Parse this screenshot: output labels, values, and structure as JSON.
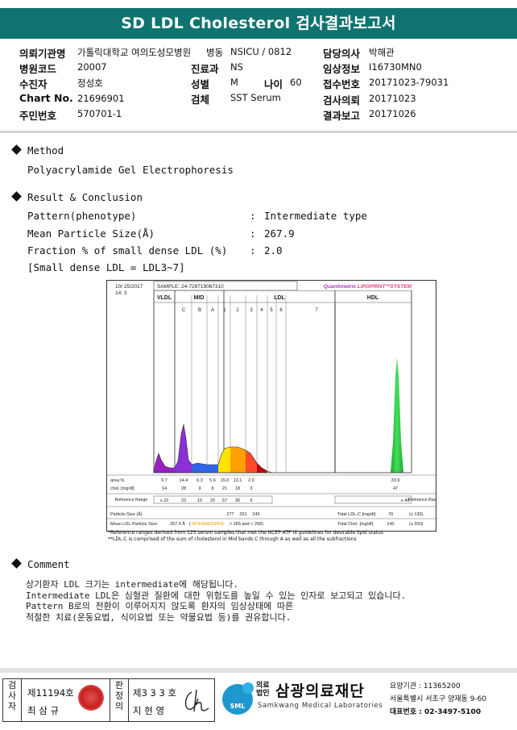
{
  "header": {
    "title": "SD LDL Cholesterol 검사결과보고서"
  },
  "info": {
    "institution_label": "의뢰기관명",
    "institution": "가톨릭대학교 여의도성모병원",
    "ward_label": "병동",
    "ward": "NSICU / 0812",
    "doctor_label": "담당의사",
    "doctor": "박해관",
    "hospital_code_label": "병원코드",
    "hospital_code": "20007",
    "dept_label": "진료과",
    "dept": "NS",
    "clinical_label": "임상정보",
    "clinical": "I16730MN0",
    "patient_label": "수진자",
    "patient": "정성호",
    "sex_label": "성별",
    "sex": "M",
    "age_label": "나이",
    "age": "60",
    "receipt_label": "접수번호",
    "receipt": "20171023-79031",
    "chart_label": "Chart No.",
    "chart": "21696901",
    "specimen_label": "검체",
    "specimen": "SST Serum",
    "request_label": "검사의뢰",
    "request": "20171023",
    "id_label": "주민번호",
    "id": "570701-1",
    "report_label": "결과보고",
    "report": "20171026"
  },
  "method": {
    "heading": "Method",
    "text": "Polyacrylamide Gel Electrophoresis"
  },
  "result": {
    "heading": "Result & Conclusion",
    "pattern_label": "Pattern(phenotype)",
    "pattern_colon": ":",
    "pattern_value": "Intermediate type",
    "size_label": "Mean Particle Size(Å)",
    "size_colon": ":",
    "size_value": "267.9",
    "fraction_label": "Fraction % of small dense LDL (%)",
    "fraction_colon": ":",
    "fraction_value": "2.0",
    "note": "[Small dense LDL = LDL3~7]"
  },
  "chart_data": {
    "type": "area",
    "date": "10/ 25/2017",
    "time": "14: 3",
    "sample": "SAMPLE:  24-729719067310",
    "brand_a": "Quantimetrix",
    "brand_b": "LIPOPRINT",
    "brand_tm": "TM",
    "brand_c": "SYSTEM",
    "top_groups": [
      "VLDL",
      "MID",
      "LDL",
      "HDL"
    ],
    "sub_bands": [
      "C",
      "B",
      "A",
      "1",
      "2",
      "3",
      "4",
      "5",
      "6",
      "7"
    ],
    "rows": {
      "area_label": "area %",
      "area": [
        "9.7",
        "14.4",
        "6.3",
        "5.6",
        "15.0",
        "13.1",
        "2.0",
        "33.9"
      ],
      "chol_label": "chol. [mg/dl]",
      "chol": [
        "14",
        "28",
        "9",
        "8",
        "21",
        "18",
        "3",
        "47"
      ],
      "ref_label": "Reference Range",
      "ref": [
        "≤ 22",
        "23",
        "15",
        "25",
        "57",
        "30",
        "6",
        "≥ 40"
      ],
      "ref_right_label": "Reference Range",
      "size_label": "Particle-Size (Å)",
      "size": [
        "277",
        "261",
        "245"
      ],
      "mean_label": "Mean LDL-Particle Size:",
      "mean_value": "267.9 Å",
      "mean_status": "INTERMEDIATE",
      "mean_range": "> 265 and < 268)",
      "total_ldl_label": "Total LDL-C [mg/dl]:",
      "total_ldl": "79",
      "total_ldl_ref": "(≤ 130)",
      "total_chol_label": "Total Chol. [mg/dl]:",
      "total_chol": "140",
      "total_chol_ref": "(≤ 200)"
    },
    "notes": [
      "*Reference ranges derived from 125 serum samples that met the NCEP ATP III guidelines for desirable lipid status",
      "**LDL-C is comprised of the sum of cholesterol in Mid bands C through A as well as all the subfractions"
    ],
    "colors": {
      "vldl": "#9a1fc0",
      "mid_c": "#8b2fd6",
      "mid_b": "#2f66e8",
      "mid_a": "#2f66e8",
      "ldl1": "#ffe400",
      "ldl2": "#ffa000",
      "ldl3": "#ff4a2a",
      "ldl4": "#c00010",
      "hdl": "#2ccc44"
    }
  },
  "comment": {
    "heading": "Comment",
    "lines": [
      "상기환자 LDL 크기는 intermediate에 해당됩니다.",
      "Intermediate LDL은 심혈관 질환에 대한 위험도를 높일 수 있는 인자로 보고되고 있습니다.",
      "Pattern B로의 전환이 이루어지지 않도록 환자의 임상상태에 따른",
      "적절한 치료(운동요법, 식이요법 또는 약물요법 등)를 권유합니다."
    ]
  },
  "footer": {
    "inspector_label": "검사자",
    "inspector_no": "제11194호",
    "inspector_name": "최 삼 규",
    "reviewer_label": "판정의",
    "reviewer_no": "제3 3 3 호",
    "reviewer_name": "지 현 영",
    "logo_text": "SML",
    "org_small": "의료법인",
    "org_name": "삼광의료재단",
    "org_eng": "Samkwang Medical Laboratories",
    "code": "요양기관 : 11365200",
    "address": "서울특별시 서초구 양재동 9-60",
    "phone": "대표번호 : 02-3497-5100"
  }
}
